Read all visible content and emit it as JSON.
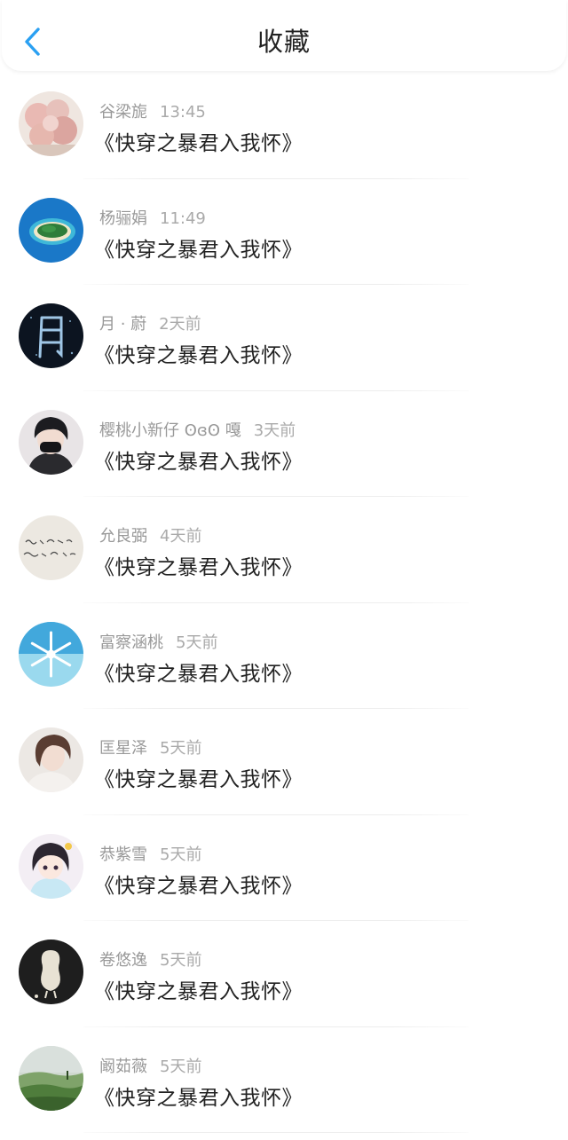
{
  "header": {
    "title": "收藏",
    "back_icon": "chevron-left-icon",
    "accent_color": "#2aa0f2"
  },
  "items": [
    {
      "name": "谷梁旎",
      "time": "13:45",
      "title": "《快穿之暴君入我怀》",
      "avatar": "pink-blossom-avatar"
    },
    {
      "name": "杨骊娟",
      "time": "11:49",
      "title": "《快穿之暴君入我怀》",
      "avatar": "island-avatar"
    },
    {
      "name": "月 · 蔚",
      "time": "2天前",
      "title": "《快穿之暴君入我怀》",
      "avatar": "moon-character-avatar"
    },
    {
      "name": "樱桃小新仔 ʘɞʘ 嘎",
      "time": "3天前",
      "title": "《快穿之暴君入我怀》",
      "avatar": "masked-boy-avatar"
    },
    {
      "name": "允良弼",
      "time": "4天前",
      "title": "《快穿之暴君入我怀》",
      "avatar": "handwriting-avatar"
    },
    {
      "name": "富察涵桃",
      "time": "5天前",
      "title": "《快穿之暴君入我怀》",
      "avatar": "snowflake-avatar"
    },
    {
      "name": "匡星泽",
      "time": "5天前",
      "title": "《快穿之暴君入我怀》",
      "avatar": "girl-portrait-avatar"
    },
    {
      "name": "恭紫雪",
      "time": "5天前",
      "title": "《快穿之暴君入我怀》",
      "avatar": "anime-girl-avatar"
    },
    {
      "name": "卷悠逸",
      "time": "5天前",
      "title": "《快穿之暴君入我怀》",
      "avatar": "peanut-avatar"
    },
    {
      "name": "阚茹薇",
      "time": "5天前",
      "title": "《快穿之暴君入我怀》",
      "avatar": "landscape-avatar"
    }
  ]
}
